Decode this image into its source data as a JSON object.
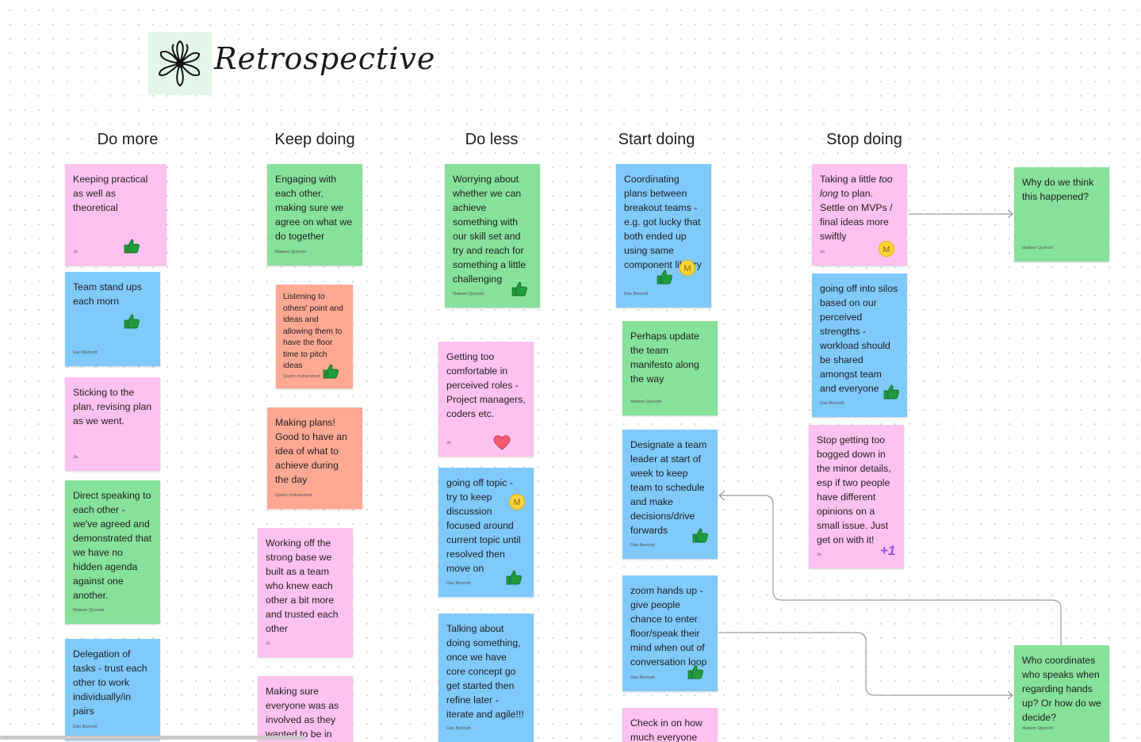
{
  "board": {
    "title": "Retrospective",
    "logo_icon": "flower-doodle-icon"
  },
  "columns": [
    {
      "id": "do-more",
      "title": "Do more"
    },
    {
      "id": "keep-doing",
      "title": "Keep doing"
    },
    {
      "id": "do-less",
      "title": "Do less"
    },
    {
      "id": "start-doing",
      "title": "Start doing"
    },
    {
      "id": "stop-doing",
      "title": "Stop doing"
    }
  ],
  "colors": {
    "pink": "#ffc1f0",
    "blue": "#7fc9fb",
    "green": "#86e19b",
    "salmon": "#ffa994",
    "thumbs": "#1f9d3a",
    "heart": "#f25a6e",
    "avatar": "#ffd43b",
    "plusone": "#9a4ee5"
  },
  "notes": {
    "n1": {
      "text": "Keeping practical as well as theoretical",
      "author": "Jo"
    },
    "n2": {
      "text": "Team stand ups each morn",
      "author": "Dan Bennett"
    },
    "n3": {
      "text": "Sticking to the plan, revising plan as we went.",
      "author": "Jo"
    },
    "n4": {
      "text": "Direct speaking to each other - we've agreed and demonstrated that we have no hidden agenda against one another.",
      "author": "Mateen Qureshi"
    },
    "n5": {
      "text": "Delegation of tasks - trust each other to work individually/in pairs",
      "author": "Dan Bennett"
    },
    "n6": {
      "text": "Engaging with each other, making sure we agree on what we do together",
      "author": "Mateen Qureshi"
    },
    "n7": {
      "text": "Listening to others' point and ideas and allowing them to have the floor time to pitch ideas",
      "author": "Qasim mohammed"
    },
    "n8": {
      "text": "Making plans! Good to have an idea of what to achieve during the day",
      "author": "Qasim mohammed"
    },
    "n9": {
      "text": "Working off the strong base we built as a team who knew each other a bit more and trusted each other",
      "author": "Jo"
    },
    "n10": {
      "text": "Making sure everyone was as involved as they wanted to be in",
      "author": ""
    },
    "n11": {
      "text": "Worrying about whether we can achieve something with our skill set and try and reach for something a little challenging",
      "author": "Mateen Qureshi"
    },
    "n12": {
      "text": "Getting too comfortable in perceived roles - Project managers, coders etc.",
      "author": "Jo"
    },
    "n13": {
      "text": "going off topic - try to keep discussion focused around current topic until resolved then move on",
      "author": "Dan Bennett"
    },
    "n14": {
      "text": "Talking about doing something, once we have core concept go get started then refine later - iterate and agile!!!",
      "author": "Dan Bennett"
    },
    "n15": {
      "text": "Coordinating plans between breakout teams - e.g. got lucky that both ended up using same component library",
      "author": "Dan Bennett"
    },
    "n16": {
      "text": "Perhaps update the team manifesto along the way",
      "author": "Mateen Qureshi"
    },
    "n17": {
      "text": "Designate a team leader at start of week to keep team to schedule and make decisions/drive forwards",
      "author": "Dan Bennett"
    },
    "n18": {
      "text": "zoom hands up - give people chance to enter floor/speak their mind when out of conversation loop",
      "author": "Dan Bennett"
    },
    "n19": {
      "text": "Check in on how much everyone",
      "author": ""
    },
    "n20": {
      "text_a": "Taking a little ",
      "text_em1": "too long",
      "text_b": " to plan. Settle on MVPs / final ideas more swiftly",
      "author": "Jo"
    },
    "n21": {
      "text": "going off into silos based on our perceived strengths - workload should be shared amongst team and everyone",
      "author": "Dan Bennett"
    },
    "n22": {
      "text": "Stop getting too bogged down in the minor details, esp if two people have different opinions on a small issue. Just get on with it!",
      "author": "Jo"
    },
    "n23": {
      "text": "Why do we think this happened?",
      "author": "Mateen Qureshi"
    },
    "n24": {
      "text": "Who coordinates who speaks when regarding hands up? Or how do we decide?",
      "author": "Mateen Qureshi"
    }
  },
  "reactions": {
    "avatar_initial": "M",
    "plus_one": "+1"
  }
}
